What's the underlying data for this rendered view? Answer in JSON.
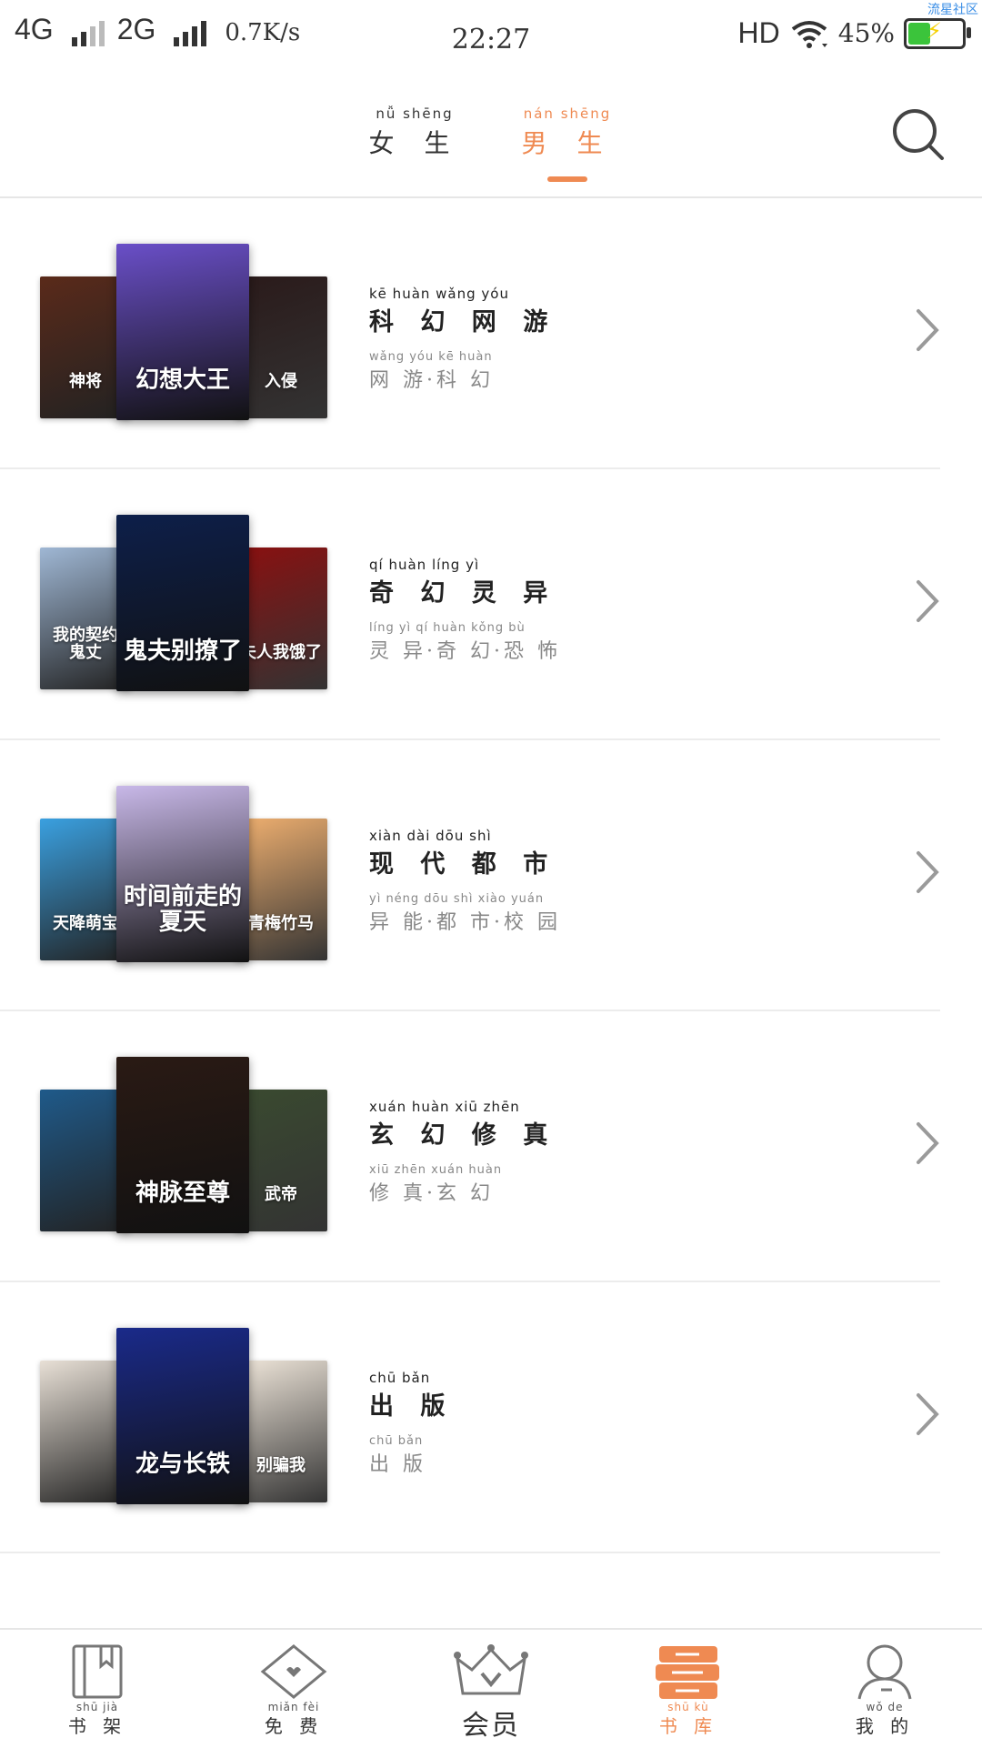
{
  "status_bar": {
    "network_1": "4G",
    "network_2": "2G",
    "speed": "0.7K/s",
    "time": "22:27",
    "hd": "HD",
    "battery_percent": "45%",
    "battery_level": 0.45,
    "watermark": "流星社区"
  },
  "top_tabs": [
    {
      "pinyin": "nǚ shēng",
      "label": "女 生",
      "active": false
    },
    {
      "pinyin": "nán shēng",
      "label": "男 生",
      "active": true
    }
  ],
  "categories": [
    {
      "title_pinyin": "kē huàn wǎng yóu",
      "title": "科 幻 网 游",
      "sub_pinyin": "wǎng yóu   kē huàn",
      "sub": "网 游·科 幻",
      "cover_left": "神将",
      "cover_mid": "幻想大王",
      "cover_right": "入侵",
      "colors": [
        "#5a2a1a",
        "#6a4fc8",
        "#2a1a1a"
      ]
    },
    {
      "title_pinyin": "qí huàn líng  yì",
      "title": "奇 幻 灵 异",
      "sub_pinyin": "líng  yì   qí huàn kǒng bù",
      "sub": "灵 异·奇 幻·恐 怖",
      "cover_left": "我的契约鬼丈",
      "cover_mid": "鬼夫别撩了",
      "cover_right": "夫人我饿了",
      "colors": [
        "#9fb7d4",
        "#0d1f4a",
        "#8a1010"
      ]
    },
    {
      "title_pinyin": "xiàn dài dōu  shì",
      "title": "现 代 都 市",
      "sub_pinyin": " yì néng dōu  shì  xiào yuán",
      "sub": "异 能·都 市·校 园",
      "cover_left": "天降萌宝",
      "cover_mid": "时间前走的夏天",
      "cover_right": "青梅竹马",
      "colors": [
        "#3aa0e0",
        "#c8b8e8",
        "#f0b070"
      ]
    },
    {
      "title_pinyin": "xuán huàn xiū zhēn",
      "title": "玄 幻 修 真",
      "sub_pinyin": "xiū zhēn xuán huàn",
      "sub": "修 真·玄 幻",
      "cover_left": "",
      "cover_mid": "神脉至尊",
      "cover_right": "武帝",
      "colors": [
        "#1f5a8a",
        "#2a1a14",
        "#3a4a30"
      ]
    },
    {
      "title_pinyin": "chū bǎn",
      "title": "出 版",
      "sub_pinyin": "chū bǎn",
      "sub": "出 版",
      "cover_left": "",
      "cover_mid": "龙与长铁",
      "cover_right": "别骗我",
      "colors": [
        "#e8e0d6",
        "#1a2a8a",
        "#efe6da"
      ]
    }
  ],
  "bottom_nav": [
    {
      "pinyin": "shū  jià",
      "label": "书 架",
      "active": false
    },
    {
      "pinyin": "miǎn  fèi",
      "label": "免 费",
      "active": false
    },
    {
      "pinyin": "",
      "label": "会员",
      "active": false
    },
    {
      "pinyin": "shū  kù",
      "label": "书 库",
      "active": true
    },
    {
      "pinyin": "wǒ  de",
      "label": "我 的",
      "active": false
    }
  ]
}
